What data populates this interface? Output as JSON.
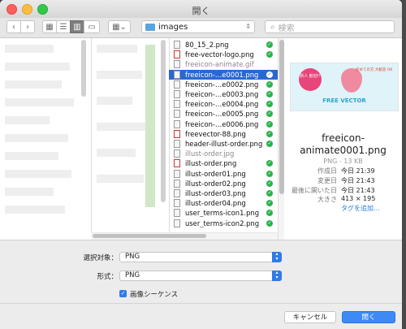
{
  "window": {
    "title": "開く"
  },
  "toolbar": {
    "back_icon": "chevron-left-icon",
    "forward_icon": "chevron-right-icon",
    "location": "images",
    "search_placeholder": "検索"
  },
  "files": [
    {
      "name": "80_15_2.png",
      "checked": true,
      "icon": "image",
      "state": "normal"
    },
    {
      "name": "free-vector-logo.png",
      "checked": true,
      "icon": "image-red",
      "state": "normal"
    },
    {
      "name": "freeicon-animate.gif",
      "checked": false,
      "icon": "image",
      "state": "gray"
    },
    {
      "name": "freeicon-…e0001.png",
      "checked": true,
      "icon": "image",
      "state": "selected"
    },
    {
      "name": "freeicon-…e0002.png",
      "checked": true,
      "icon": "image",
      "state": "normal"
    },
    {
      "name": "freeicon-…e0003.png",
      "checked": true,
      "icon": "image",
      "state": "normal"
    },
    {
      "name": "freeicon-…e0004.png",
      "checked": true,
      "icon": "image",
      "state": "normal"
    },
    {
      "name": "freeicon-…e0005.png",
      "checked": true,
      "icon": "image",
      "state": "normal"
    },
    {
      "name": "freeicon-…e0006.png",
      "checked": true,
      "icon": "image",
      "state": "normal"
    },
    {
      "name": "freevector-88.png",
      "checked": true,
      "icon": "image-red",
      "state": "normal"
    },
    {
      "name": "header-illust-order.png",
      "checked": true,
      "icon": "image",
      "state": "normal"
    },
    {
      "name": "illust-order.jpg",
      "checked": false,
      "icon": "image",
      "state": "gray"
    },
    {
      "name": "illust-order.png",
      "checked": true,
      "icon": "image-red",
      "state": "normal"
    },
    {
      "name": "illust-order01.png",
      "checked": true,
      "icon": "image",
      "state": "normal"
    },
    {
      "name": "illust-order02.png",
      "checked": true,
      "icon": "image",
      "state": "normal"
    },
    {
      "name": "illust-order03.png",
      "checked": true,
      "icon": "image",
      "state": "normal"
    },
    {
      "name": "illust-order04.png",
      "checked": true,
      "icon": "image",
      "state": "normal"
    },
    {
      "name": "user_terms-icon1.png",
      "checked": true,
      "icon": "image",
      "state": "normal"
    },
    {
      "name": "user_terms-icon2.png",
      "checked": true,
      "icon": "image",
      "state": "normal"
    }
  ],
  "preview": {
    "thumb_badge": "新人 歓迎!!",
    "thumb_text": "初めての方 大歓迎 OK",
    "thumb_brand": "FREE VECTOR",
    "name": "freeicon-animate0001.png",
    "subtitle": "PNG - 13 KB",
    "meta": [
      {
        "key": "作成日",
        "value": "今日 21:39"
      },
      {
        "key": "変更日",
        "value": "今日 21:43"
      },
      {
        "key": "最後に開いた日",
        "value": "今日 21:43"
      },
      {
        "key": "大きさ",
        "value": "413 × 195"
      }
    ],
    "add_tag": "タグを追加..."
  },
  "options": {
    "selection_label": "選択対象：",
    "selection_value": "PNG",
    "format_label": "形式：",
    "format_value": "PNG",
    "sequence_label": "画像シーケンス",
    "sequence_checked": true
  },
  "buttons": {
    "cancel": "キャンセル",
    "open": "開く"
  }
}
